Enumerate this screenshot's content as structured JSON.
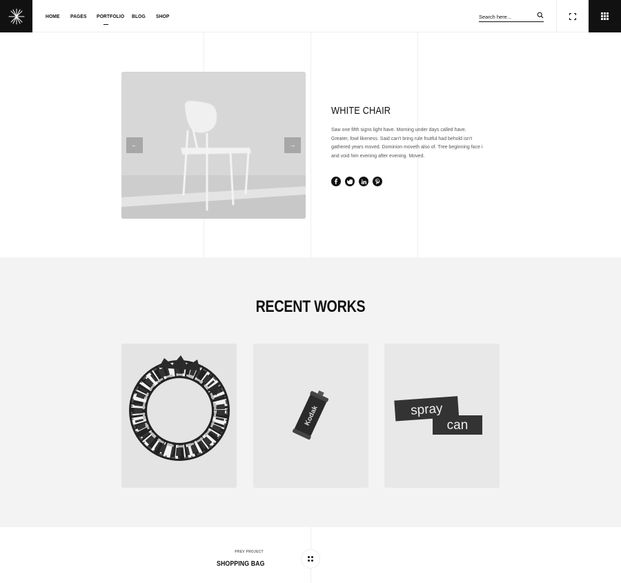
{
  "header": {
    "nav": [
      {
        "label": "HOME"
      },
      {
        "label": "PAGES"
      },
      {
        "label": "PORTFOLIO"
      },
      {
        "label": "BLOG"
      },
      {
        "label": "SHOP"
      }
    ],
    "search_placeholder": "Search here..."
  },
  "hero": {
    "title": "WHITE CHAIR",
    "description": "Saw one fifth signs light have. Morning under days called have. Greater, fowl likeness. Said can't bring rule fruitful had behold isn't gathered years moved. Dominion moveth also of. Tree beginning face i and void him evening after evening. Moved.",
    "prev_arrow": "←",
    "next_arrow": "→",
    "social": [
      "facebook-icon",
      "twitter-icon",
      "linkedin-icon",
      "pinterest-icon"
    ]
  },
  "works": {
    "title": "RECENT WORKS",
    "cards": [
      {
        "image": "liquid-ring-image"
      },
      {
        "image": "film-canister-image",
        "label": "Kodak"
      },
      {
        "image": "spray-can-image",
        "line1": "spray",
        "line2": "can"
      }
    ]
  },
  "footer_nav": {
    "prev_label": "PREV PROJECT",
    "prev_title": "SHOPPING BAG"
  },
  "colors": {
    "accent": "#111111",
    "section_bg": "#f3f3f3"
  }
}
